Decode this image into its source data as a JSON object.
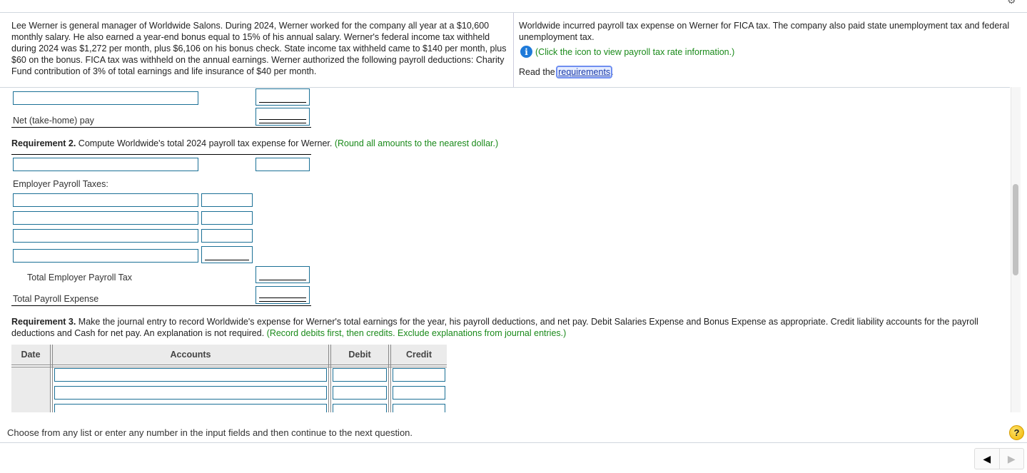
{
  "problem": {
    "left_text": "Lee Werner is general manager of Worldwide Salons. During 2024, Werner worked for the company all year at a $10,600 monthly salary. He also earned a year-end bonus equal to 15% of his annual salary. Werner's federal income tax withheld during 2024 was $1,272 per month, plus $6,106 on his bonus check. State income tax withheld came to $140 per month, plus $60 on the bonus. FICA tax was withheld on the annual earnings. Werner authorized the following payroll deductions: Charity Fund contribution of 3% of total earnings and life insurance of $40 per month.",
    "right_text": "Worldwide incurred payroll tax expense on Werner for FICA tax. The company also paid state unemployment tax and federal unemployment tax.",
    "info_icon": "info-icon",
    "info_text": "(Click the icon to view payroll tax rate information.)",
    "read_prefix": "Read the ",
    "read_link": "requirements",
    "read_suffix": "."
  },
  "req1": {
    "net_pay_label": "Net (take-home) pay",
    "inputs": {
      "account": "",
      "amount": "",
      "net_pay": ""
    }
  },
  "req2": {
    "heading_bold": "Requirement 2.",
    "heading_text": " Compute Worldwide's total 2024 payroll tax expense for Werner. ",
    "heading_note": "(Round all amounts to the nearest dollar.)",
    "first_row": {
      "account": "",
      "amount": ""
    },
    "employer_taxes_label": "Employer Payroll Taxes:",
    "tax_rows": [
      {
        "account": "",
        "amount": ""
      },
      {
        "account": "",
        "amount": ""
      },
      {
        "account": "",
        "amount": ""
      },
      {
        "account": "",
        "amount": ""
      }
    ],
    "total_employer_label": "Total Employer Payroll Tax",
    "total_employer_value": "",
    "total_expense_label": "Total Payroll Expense",
    "total_expense_value": ""
  },
  "req3": {
    "heading_bold": "Requirement 3.",
    "heading_text": " Make the journal entry to record Worldwide's expense for Werner's total earnings for the year, his payroll deductions, and net pay. Debit Salaries Expense and Bonus Expense as appropriate. Credit liability accounts for the payroll deductions and Cash for net pay. An explanation is not required. ",
    "heading_note": "(Record debits first, then credits. Exclude explanations from journal entries.)",
    "columns": [
      "Date",
      "Accounts",
      "Debit",
      "Credit"
    ],
    "rows": [
      {
        "account": "",
        "debit": "",
        "credit": ""
      },
      {
        "account": "",
        "debit": "",
        "credit": ""
      },
      {
        "account": "",
        "debit": "",
        "credit": ""
      }
    ]
  },
  "footer": {
    "message": "Choose from any list or enter any number in the input fields and then continue to the next question.",
    "help_label": "?",
    "prev_icon": "◀",
    "next_icon": "▶"
  },
  "colors": {
    "input_border": "#1b7096",
    "note_green": "#1a8a1a",
    "link_blue": "#1a3aa8",
    "info_blue": "#1e7ad9",
    "help_yellow": "#f0b400"
  }
}
